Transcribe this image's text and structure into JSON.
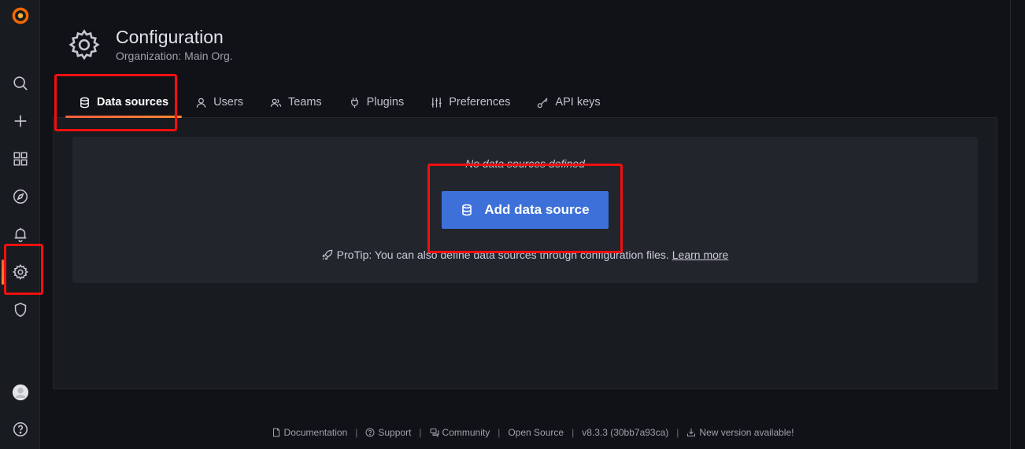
{
  "header": {
    "title": "Configuration",
    "subtitle": "Organization: Main Org."
  },
  "tabs": [
    {
      "label": "Data sources",
      "icon": "database-icon",
      "active": true
    },
    {
      "label": "Users",
      "icon": "user-icon"
    },
    {
      "label": "Teams",
      "icon": "users-icon"
    },
    {
      "label": "Plugins",
      "icon": "plug-icon"
    },
    {
      "label": "Preferences",
      "icon": "sliders-icon"
    },
    {
      "label": "API keys",
      "icon": "key-icon"
    }
  ],
  "empty": {
    "message": "No data sources defined",
    "button_label": "Add data source",
    "protip": "ProTip: You can also define data sources through configuration files.",
    "learn_more": "Learn more"
  },
  "footer": {
    "documentation": "Documentation",
    "support": "Support",
    "community": "Community",
    "open_source": "Open Source",
    "version": "v8.3.3 (30bb7a93ca)",
    "new_version": "New version available!"
  },
  "colors": {
    "accent": "#3d71d9",
    "active_tab": "#f55f3e",
    "highlight_box": "#f20f0f"
  }
}
